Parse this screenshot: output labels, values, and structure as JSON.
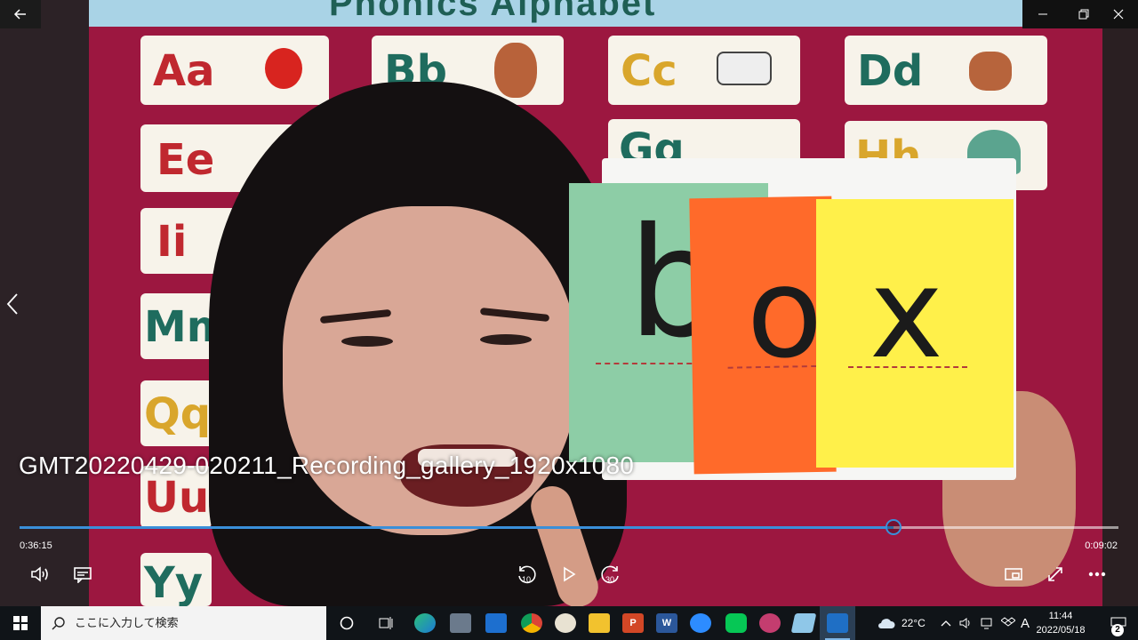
{
  "window": {
    "back_icon": "arrow-left-icon",
    "minimize_icon": "minimize-icon",
    "maximize_icon": "restore-icon",
    "close_icon": "close-icon"
  },
  "video": {
    "title": "GMT20220429-020211_Recording_gallery_1920x1080",
    "poster_title": "Phonics Alphabet",
    "poster_letters": [
      "Aa",
      "Bb",
      "Cc",
      "Dd",
      "Ee",
      "Gg",
      "Hh",
      "Ii",
      "Mm",
      "Qq",
      "Uu",
      "Yy"
    ],
    "card_letters": [
      "b",
      "o",
      "x"
    ],
    "card_colors": [
      "#8dcda6",
      "#ff6a2a",
      "#fff04a"
    ]
  },
  "player": {
    "elapsed": "0:36:15",
    "remaining": "0:09:02",
    "progress": 0.795,
    "accent_color": "#3a8fd9",
    "skip_back_label": "10",
    "skip_forward_label": "30",
    "controls": [
      "volume-icon",
      "subtitles-icon",
      "skip-back-icon",
      "play-icon",
      "skip-forward-icon",
      "miniplayer-icon",
      "fullscreen-icon",
      "more-icon"
    ]
  },
  "taskbar": {
    "search_placeholder": "ここに入力して検索",
    "apps": [
      "cortana-icon",
      "task-view-icon",
      "edge-icon",
      "app-icon",
      "mail-icon",
      "chrome-icon",
      "paint-icon",
      "file-explorer-icon",
      "powerpoint-icon",
      "word-icon",
      "zoom-icon",
      "line-icon",
      "paint3d-icon",
      "app2-icon",
      "movies-tv-icon"
    ],
    "weather": "22°C",
    "ime": "A",
    "time": "11:44",
    "date": "2022/05/18",
    "notification_count": "2"
  }
}
